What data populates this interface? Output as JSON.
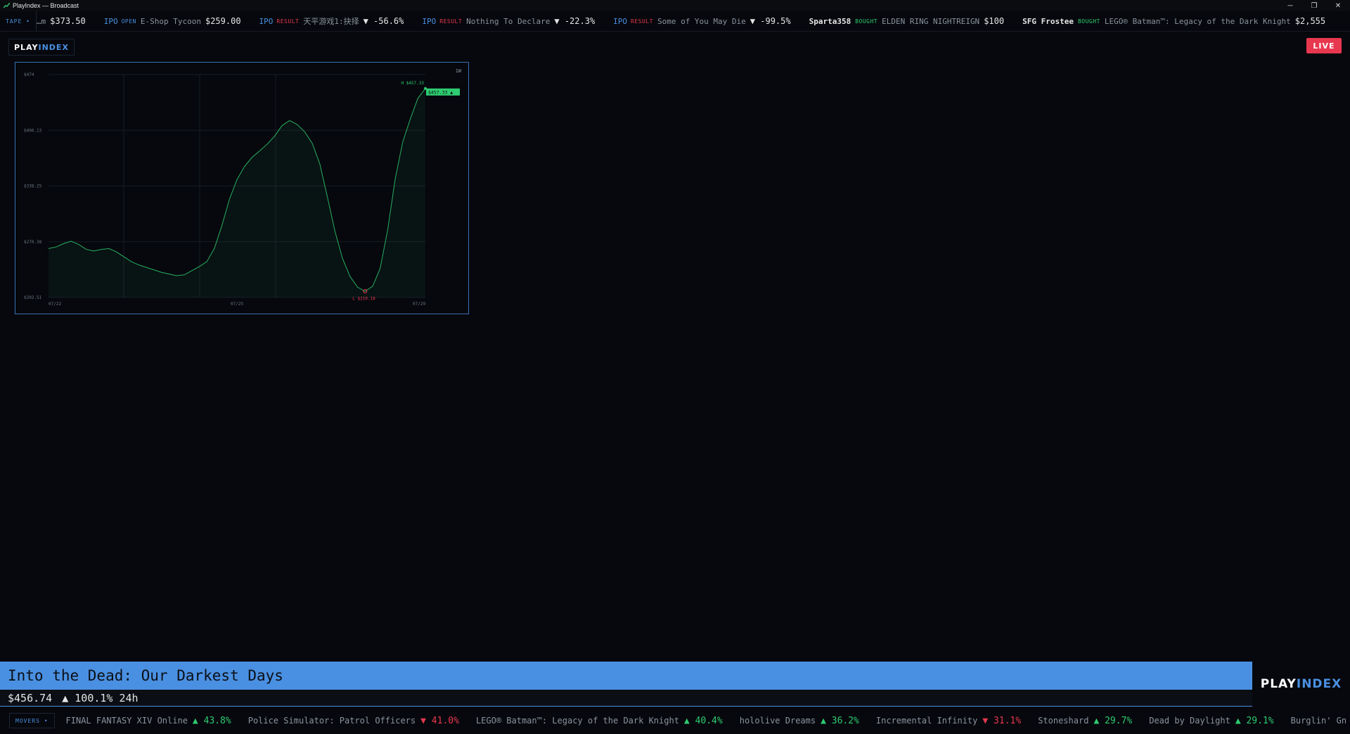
{
  "window": {
    "title": "PlayIndex — Broadcast",
    "minimize": "─",
    "restore": "❐",
    "close": "✕"
  },
  "tape": {
    "label": "TAPE •",
    "items": [
      {
        "kind": "price",
        "name": "…m",
        "price": "$373.50"
      },
      {
        "kind": "ipo_open",
        "ipo": "IPO",
        "tag": "OPEN",
        "name": "E-Shop Tycoon",
        "price": "$259.00"
      },
      {
        "kind": "ipo_result",
        "ipo": "IPO",
        "tag": "RESULT",
        "name": "天平游戏1:抉择",
        "change": "▼ -56.6%"
      },
      {
        "kind": "ipo_result",
        "ipo": "IPO",
        "tag": "RESULT",
        "name": "Nothing To Declare",
        "change": "▼ -22.3%"
      },
      {
        "kind": "ipo_result",
        "ipo": "IPO",
        "tag": "RESULT",
        "name": "Some of You May Die",
        "change": "▼ -99.5%"
      },
      {
        "kind": "bought",
        "user": "Sparta358",
        "tag": "BOUGHT",
        "name": "ELDEN RING NIGHTREIGN",
        "price": "$100"
      },
      {
        "kind": "bought",
        "user": "SFG Frostee",
        "tag": "BOUGHT",
        "name": "LEGO® Batman™: Legacy of the Dark Knight",
        "price": "$2,555"
      }
    ]
  },
  "brand": {
    "play": "PLAY",
    "index": "INDEX",
    "live": "LIVE"
  },
  "chart_panel": {
    "range_label": "1W",
    "accent": "#2ecc71",
    "high_label": "H $457.33",
    "low_label": "L $210.18",
    "current_label": "$457.33 ▲"
  },
  "chart_data": {
    "type": "area",
    "y_ticks": [
      "$474",
      "$406.13",
      "$338.25",
      "$270.38",
      "$202.51"
    ],
    "ylim": [
      202.51,
      474
    ],
    "x_ticks": [
      "07/22",
      "07/25",
      "07/29"
    ],
    "series": [
      {
        "values": [
          262,
          264,
          268,
          271,
          267,
          261,
          259,
          261,
          262,
          258,
          252,
          246,
          242,
          239,
          236,
          233,
          231,
          229,
          230,
          235,
          240,
          246,
          262,
          290,
          322,
          346,
          362,
          373,
          381,
          389,
          399,
          412,
          418,
          413,
          404,
          390,
          365,
          325,
          283,
          250,
          228,
          215,
          210,
          216,
          238,
          285,
          347,
          392,
          420,
          445,
          457
        ]
      }
    ],
    "high": 457.33,
    "low": 210.18
  },
  "lower_third": {
    "title": "Into the Dead: Our Darkest Days",
    "price": "$456.74",
    "change": "▲ 100.1% 24h"
  },
  "movers": {
    "label": "MOVERS •",
    "items": [
      {
        "name": "FINAL FANTASY XIV Online",
        "change": "▲ 43.8%",
        "dir": "up"
      },
      {
        "name": "Police Simulator: Patrol Officers",
        "change": "▼ 41.0%",
        "dir": "down"
      },
      {
        "name": "LEGO® Batman™: Legacy of the Dark Knight",
        "change": "▲ 40.4%",
        "dir": "up"
      },
      {
        "name": "hololive Dreams",
        "change": "▲ 36.2%",
        "dir": "up"
      },
      {
        "name": "Incremental Infinity",
        "change": "▼ 31.1%",
        "dir": "down"
      },
      {
        "name": "Stoneshard",
        "change": "▲ 29.7%",
        "dir": "up"
      },
      {
        "name": "Dead by Daylight",
        "change": "▲ 29.1%",
        "dir": "up"
      },
      {
        "name": "Burglin' Gn",
        "change": "",
        "dir": "up"
      }
    ]
  }
}
